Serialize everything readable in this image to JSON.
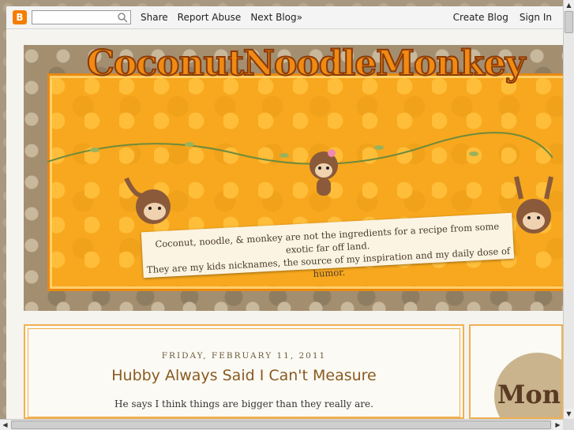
{
  "navbar": {
    "logo_letter": "B",
    "search_placeholder": "",
    "share": "Share",
    "report_abuse": "Report Abuse",
    "next_blog": "Next Blog»",
    "create_blog": "Create Blog",
    "sign_in": "Sign In"
  },
  "header": {
    "title": "CoconutNoodleMonkey",
    "tagline_line1": "Coconut, noodle, & monkey are not the ingredients for a recipe from some exotic far off land.",
    "tagline_line2": "They are my kids nicknames, the source of my inspiration and my daily dose of humor."
  },
  "post": {
    "date": "FRIDAY, FEBRUARY 11, 2011",
    "title": "Hubby Always Said I Can't Measure",
    "body": "He says I think things are bigger than they really are."
  },
  "sidebar": {
    "badge_text": "Monk"
  },
  "colors": {
    "accent": "#f7a81e",
    "title": "#8a5a20",
    "border": "#f0b050"
  }
}
